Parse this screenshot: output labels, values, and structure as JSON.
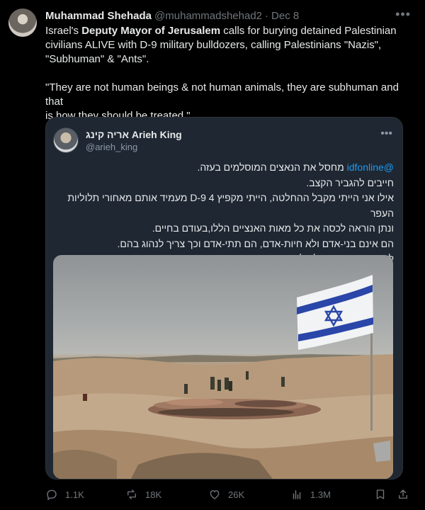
{
  "post": {
    "author_name": "Muhammad Shehada",
    "author_handle": "@muhammadshehad2",
    "separator": "·",
    "date": "Dec 8",
    "line1_a": "Israel's ",
    "line1_b": "Deputy Mayor of Jerusalem",
    "line1_c": " calls for burying detained Palestinian",
    "line2": "civilians ALIVE with D-9 military bulldozers, calling Palestinians \"Nazis\",",
    "line3": "\"Subhuman\" & \"Ants\".",
    "quote_line1": "\"They are not human beings & not human animals, they are subhuman and that",
    "quote_line2": "is how they should be treated.\""
  },
  "quoted": {
    "author_name": "אריה קינג Arieh King",
    "author_handle": "@arieh_king",
    "mention": "@idfonline",
    "line1": "מחסל את הנאצים המוסלמים בעזה.",
    "line2": "חייבים להגביר הקצב.",
    "line3": "אילו אני הייתי מקבל ההחלטה, הייתי מקפיץ 4 D-9 מעמיד אותם מאחורי תלוליות העפר",
    "line4": "ונתן הוראה לכסה את כל מאות האנציים הללו,בעודם בחיים.",
    "line5": "הם אינם בני-אדם ולא חיות-אדם, הם תתי-אדם וכך צריך לנהוג בהם.",
    "line6": "למחות את זכר עמלק,לא נשכח."
  },
  "actions": {
    "replies": "1.1K",
    "reposts": "18K",
    "likes": "26K",
    "views": "1.3M"
  },
  "icons": [
    "more-icon",
    "reply-icon",
    "repost-icon",
    "like-icon",
    "views-icon",
    "bookmark-icon",
    "share-icon"
  ],
  "colors": {
    "background": "#000000",
    "text": "#e7e9ea",
    "muted": "#71767b",
    "link": "#1d9bf0",
    "card": "#1e2732"
  }
}
